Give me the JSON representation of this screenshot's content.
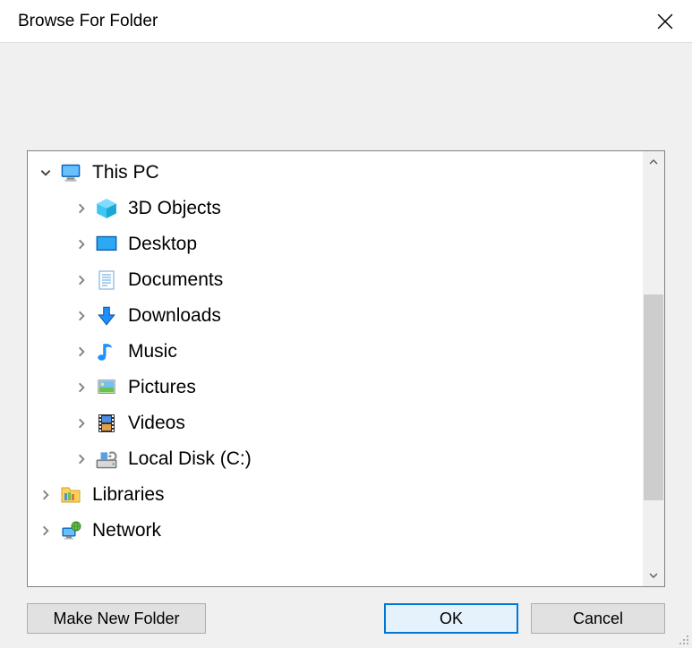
{
  "dialog": {
    "title": "Browse For Folder"
  },
  "tree": {
    "this_pc": {
      "label": "This PC"
    },
    "objects3d": {
      "label": "3D Objects"
    },
    "desktop": {
      "label": "Desktop"
    },
    "documents": {
      "label": "Documents"
    },
    "downloads": {
      "label": "Downloads"
    },
    "music": {
      "label": "Music"
    },
    "pictures": {
      "label": "Pictures"
    },
    "videos": {
      "label": "Videos"
    },
    "local_disk": {
      "label": "Local Disk (C:)"
    },
    "libraries": {
      "label": "Libraries"
    },
    "network": {
      "label": "Network"
    }
  },
  "buttons": {
    "make_new": "Make New Folder",
    "ok": "OK",
    "cancel": "Cancel"
  }
}
